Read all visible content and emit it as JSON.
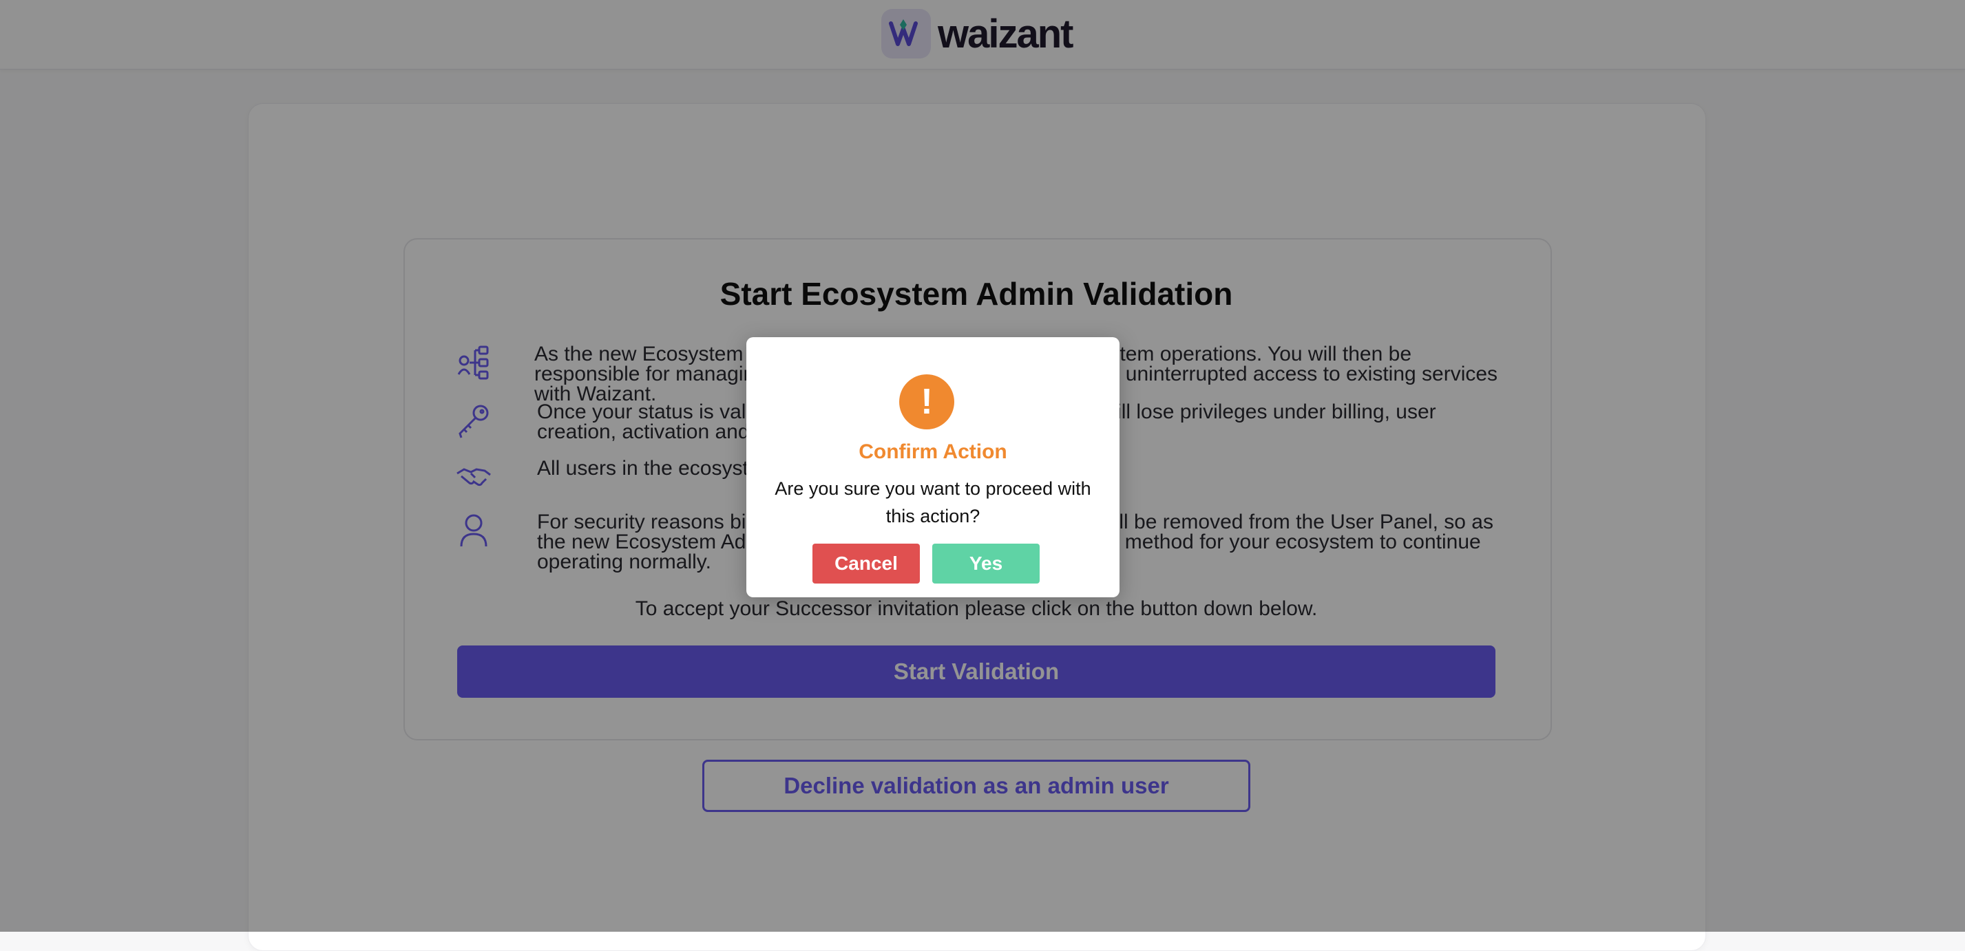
{
  "header": {
    "brand_name": "waizant",
    "logo_icon": "waizant-logo-icon"
  },
  "page": {
    "title": "Start Ecosystem Admin Validation",
    "items": [
      {
        "icon": "organization-chart-icon",
        "text": "As the new Ecosystem Admin you will take control of the ecosystem operations. You will then be responsible for managing members, roles and billing to maintain uninterrupted access to existing services with Waizant."
      },
      {
        "icon": "key-icon",
        "text": "Once your status is validated, the previous Ecosystem Admin will lose privileges under billing, user creation, activation and deactivation."
      },
      {
        "icon": "handshake-icon",
        "text": "All users in the ecosystem will be notified of the change."
      },
      {
        "icon": "user-icon",
        "text": "For security reasons billing information of the previous admin will be removed from the User Panel, so as the new Ecosystem Admin, you will need to add a new payment method for your ecosystem to continue operating normally."
      }
    ],
    "accept_text": "To accept your Successor invitation please click on the button down below.",
    "start_button": "Start Validation",
    "decline_button": "Decline validation as an admin user"
  },
  "modal": {
    "icon": "exclamation-icon",
    "icon_glyph": "!",
    "title": "Confirm Action",
    "message": "Are you sure you want to proceed with this action?",
    "cancel_label": "Cancel",
    "yes_label": "Yes"
  },
  "colors": {
    "accent": "#6a5cf0",
    "warning": "#f0892f",
    "cancel": "#e05050",
    "confirm": "#5fd3a5"
  }
}
